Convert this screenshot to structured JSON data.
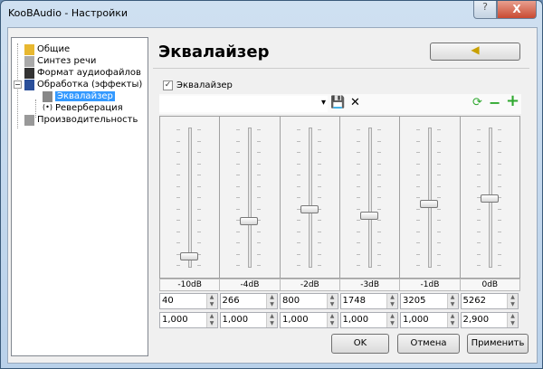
{
  "window": {
    "title": "KooBAudio - Настройки",
    "help": "?",
    "close": "X"
  },
  "tree": {
    "items": [
      {
        "label": "Общие",
        "icon": "folder-icon"
      },
      {
        "label": "Синтез речи",
        "icon": "microphone-icon"
      },
      {
        "label": "Формат аудиофайлов",
        "icon": "music-file-icon"
      },
      {
        "label": "Обработка (эффекты)",
        "icon": "effects-icon",
        "expander": "−"
      },
      {
        "label": "Эквалайзер",
        "icon": "equalizer-icon",
        "selected": true
      },
      {
        "label": "Реверберация",
        "icon": "reverb-icon",
        "glyph": "(•)"
      },
      {
        "label": "Производительность",
        "icon": "gear-icon"
      }
    ]
  },
  "panel": {
    "title": "Эквалайзер",
    "speaker_glyph": "◀",
    "enable_label": "Эквалайзер",
    "checked": "✓",
    "toolbar": {
      "dropdown": "▾",
      "save": "💾",
      "delete": "✕",
      "refresh": "⟳",
      "remove": "−",
      "add": "+"
    },
    "spin_up": "▲",
    "spin_down": "▼",
    "gain_range_db": [
      -12,
      12
    ],
    "bands": [
      {
        "label": "-10dB",
        "gain": -10,
        "freq": "40",
        "q": "1,000"
      },
      {
        "label": "-4dB",
        "gain": -4,
        "freq": "266",
        "q": "1,000"
      },
      {
        "label": "-2dB",
        "gain": -2,
        "freq": "800",
        "q": "1,000"
      },
      {
        "label": "-3dB",
        "gain": -3,
        "freq": "1748",
        "q": "1,000"
      },
      {
        "label": "-1dB",
        "gain": -1,
        "freq": "3205",
        "q": "1,000"
      },
      {
        "label": "0dB",
        "gain": 0,
        "freq": "5262",
        "q": "2,900"
      }
    ]
  },
  "buttons": {
    "ok": "OK",
    "cancel": "Отмена",
    "apply": "Применить"
  },
  "colors": {
    "selection": "#3399ff",
    "green": "#2fa82f"
  }
}
